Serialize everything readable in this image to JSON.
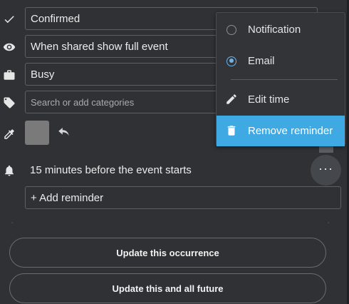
{
  "fields": {
    "status": "Confirmed",
    "visibility": "When shared show full event",
    "availability": "Busy",
    "categories_placeholder": "Search or add categories"
  },
  "reminder": {
    "text": "15 minutes before the event starts",
    "add_label": "+ Add reminder",
    "more_label": "···"
  },
  "menu": {
    "notification_label": "Notification",
    "email_label": "Email",
    "edit_time_label": "Edit time",
    "remove_label": "Remove reminder",
    "selected": "Email"
  },
  "actions": {
    "update_occurrence": "Update this occurrence",
    "update_future": "Update this and all future"
  },
  "colors": {
    "background": "#2f3134",
    "accent": "#3fa9e4",
    "swatch": "#7a7a7a"
  },
  "icons": [
    "check-icon",
    "eye-icon",
    "briefcase-icon",
    "tag-icon",
    "eyedropper-icon",
    "undo-icon",
    "bell-icon",
    "pencil-icon",
    "trash-icon"
  ]
}
